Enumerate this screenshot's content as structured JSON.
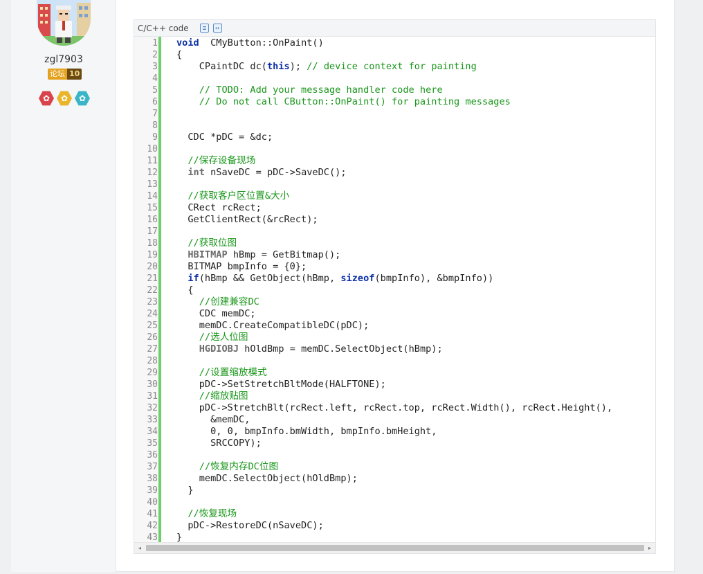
{
  "user": {
    "name": "zgl7903",
    "badge_label": "论坛",
    "badge_level": "10",
    "medal_colors": [
      "#d9434b",
      "#e9b52b",
      "#3ab5c7"
    ],
    "medal_icon": "flower-icon"
  },
  "code_block": {
    "language_label": "C/C++ code",
    "copy_icon": "copy-icon",
    "view_source_icon": "view-source-icon",
    "accent_color": "#6ccf6c",
    "lines": [
      {
        "n": "1",
        "t": [
          [
            "kw",
            "void"
          ],
          [
            "",
            "  CMyButton::OnPaint()"
          ]
        ]
      },
      {
        "n": "2",
        "t": [
          [
            "",
            "{"
          ]
        ]
      },
      {
        "n": "3",
        "t": [
          [
            "",
            "    CPaintDC dc("
          ],
          [
            "kw",
            "this"
          ],
          [
            "",
            "); "
          ],
          [
            "cm",
            "// device context for painting"
          ]
        ]
      },
      {
        "n": "4",
        "t": []
      },
      {
        "n": "5",
        "t": [
          [
            "cm",
            "    // TODO: Add your message handler code here"
          ]
        ]
      },
      {
        "n": "6",
        "t": [
          [
            "cm",
            "    // Do not call CButton::OnPaint() for painting messages"
          ]
        ]
      },
      {
        "n": "7",
        "t": []
      },
      {
        "n": "8",
        "t": []
      },
      {
        "n": "9",
        "t": [
          [
            "",
            "  CDC *pDC = &dc;"
          ]
        ]
      },
      {
        "n": "10",
        "t": []
      },
      {
        "n": "11",
        "t": [
          [
            "cm",
            "  //保存设备现场"
          ]
        ]
      },
      {
        "n": "12",
        "t": [
          [
            "",
            "  "
          ],
          [
            "ty",
            "int"
          ],
          [
            "",
            " nSaveDC = pDC->SaveDC();"
          ]
        ]
      },
      {
        "n": "13",
        "t": []
      },
      {
        "n": "14",
        "t": [
          [
            "cm",
            "  //获取客户区位置&大小"
          ]
        ]
      },
      {
        "n": "15",
        "t": [
          [
            "",
            "  CRect rcRect;"
          ]
        ]
      },
      {
        "n": "16",
        "t": [
          [
            "",
            "  GetClientRect(&rcRect);"
          ]
        ]
      },
      {
        "n": "17",
        "t": []
      },
      {
        "n": "18",
        "t": [
          [
            "cm",
            "  //获取位图"
          ]
        ]
      },
      {
        "n": "19",
        "t": [
          [
            "",
            "  "
          ],
          [
            "ty",
            "HBITMAP"
          ],
          [
            "",
            " hBmp = GetBitmap();"
          ]
        ]
      },
      {
        "n": "20",
        "t": [
          [
            "",
            "  BITMAP bmpInfo = {0};"
          ]
        ]
      },
      {
        "n": "21",
        "t": [
          [
            "",
            "  "
          ],
          [
            "kw",
            "if"
          ],
          [
            "",
            "(hBmp && GetObject(hBmp, "
          ],
          [
            "kw",
            "sizeof"
          ],
          [
            "",
            "(bmpInfo), &bmpInfo))"
          ]
        ]
      },
      {
        "n": "22",
        "t": [
          [
            "",
            "  {"
          ]
        ]
      },
      {
        "n": "23",
        "t": [
          [
            "cm",
            "    //创建兼容DC"
          ]
        ]
      },
      {
        "n": "24",
        "t": [
          [
            "",
            "    CDC memDC;"
          ]
        ]
      },
      {
        "n": "25",
        "t": [
          [
            "",
            "    memDC.CreateCompatibleDC(pDC);"
          ]
        ]
      },
      {
        "n": "26",
        "t": [
          [
            "cm",
            "    //选人位图"
          ]
        ]
      },
      {
        "n": "27",
        "t": [
          [
            "",
            "    "
          ],
          [
            "ty",
            "HGDIOBJ"
          ],
          [
            "",
            " hOldBmp = memDC.SelectObject(hBmp);"
          ]
        ]
      },
      {
        "n": "28",
        "t": []
      },
      {
        "n": "29",
        "t": [
          [
            "cm",
            "    //设置缩放模式"
          ]
        ]
      },
      {
        "n": "30",
        "t": [
          [
            "",
            "    pDC->SetStretchBltMode(HALFTONE);"
          ]
        ]
      },
      {
        "n": "31",
        "t": [
          [
            "cm",
            "    //缩放贴图"
          ]
        ]
      },
      {
        "n": "32",
        "t": [
          [
            "",
            "    pDC->StretchBlt(rcRect.left, rcRect.top, rcRect.Width(), rcRect.Height(),"
          ]
        ]
      },
      {
        "n": "33",
        "t": [
          [
            "",
            "      &memDC,"
          ]
        ]
      },
      {
        "n": "34",
        "t": [
          [
            "",
            "      0, 0, bmpInfo.bmWidth, bmpInfo.bmHeight,"
          ]
        ]
      },
      {
        "n": "35",
        "t": [
          [
            "",
            "      SRCCOPY);"
          ]
        ]
      },
      {
        "n": "36",
        "t": []
      },
      {
        "n": "37",
        "t": [
          [
            "cm",
            "    //恢复内存DC位图"
          ]
        ]
      },
      {
        "n": "38",
        "t": [
          [
            "",
            "    memDC.SelectObject(hOldBmp);"
          ]
        ]
      },
      {
        "n": "39",
        "t": [
          [
            "",
            "  }"
          ]
        ]
      },
      {
        "n": "40",
        "t": []
      },
      {
        "n": "41",
        "t": [
          [
            "cm",
            "  //恢复现场"
          ]
        ]
      },
      {
        "n": "42",
        "t": [
          [
            "",
            "  pDC->RestoreDC(nSaveDC);"
          ]
        ]
      },
      {
        "n": "43",
        "t": [
          [
            "",
            "}"
          ]
        ]
      }
    ]
  },
  "scrollbar": {
    "left_arrow": "◂",
    "right_arrow": "▸"
  }
}
